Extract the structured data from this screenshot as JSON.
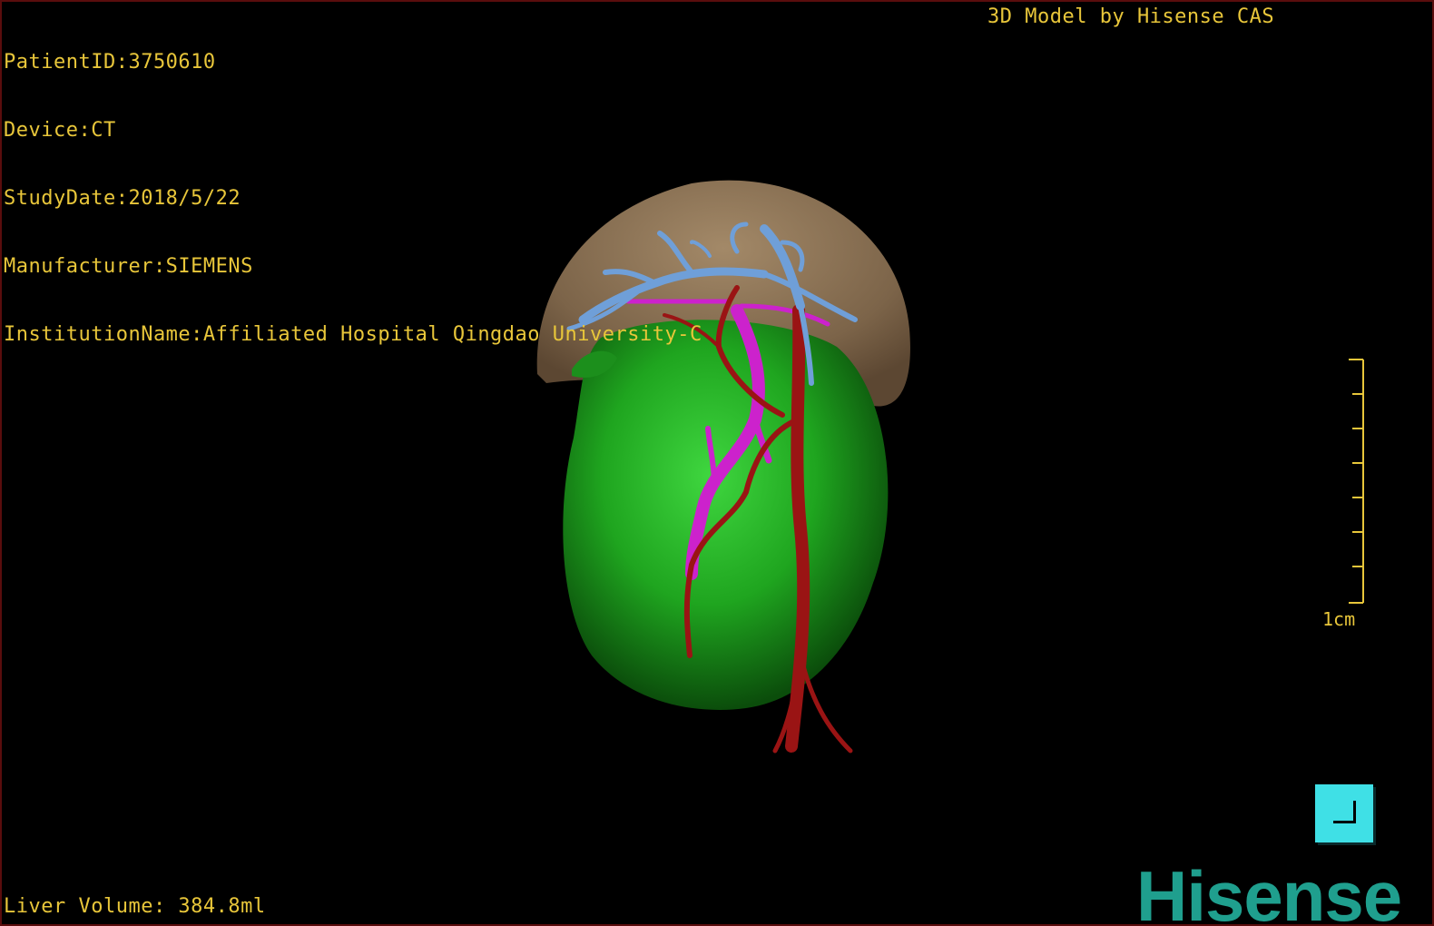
{
  "info": {
    "patient_id": "PatientID:3750610",
    "device": "Device:CT",
    "study_date": "StudyDate:2018/5/22",
    "manufacturer": "Manufacturer:SIEMENS",
    "institution": "InstitutionName:Affiliated Hospital Qingdao University-C"
  },
  "caption": "3D Model by Hisense CAS",
  "liver_volume": "Liver Volume: 384.8ml",
  "scale": {
    "label": "1cm"
  },
  "logo": "Hisense",
  "colors": {
    "overlay_text": "#e8c63a",
    "liver": "#1fa51f",
    "organ_tan": "#8a7156",
    "portal_vein": "#6f9fd8",
    "artery": "#9a1414",
    "vein_magenta": "#cc22cc",
    "reset_button": "#3fe0e6",
    "logo": "#1f9f8e"
  },
  "icons": {
    "reset_view": "corner-bracket-icon"
  }
}
